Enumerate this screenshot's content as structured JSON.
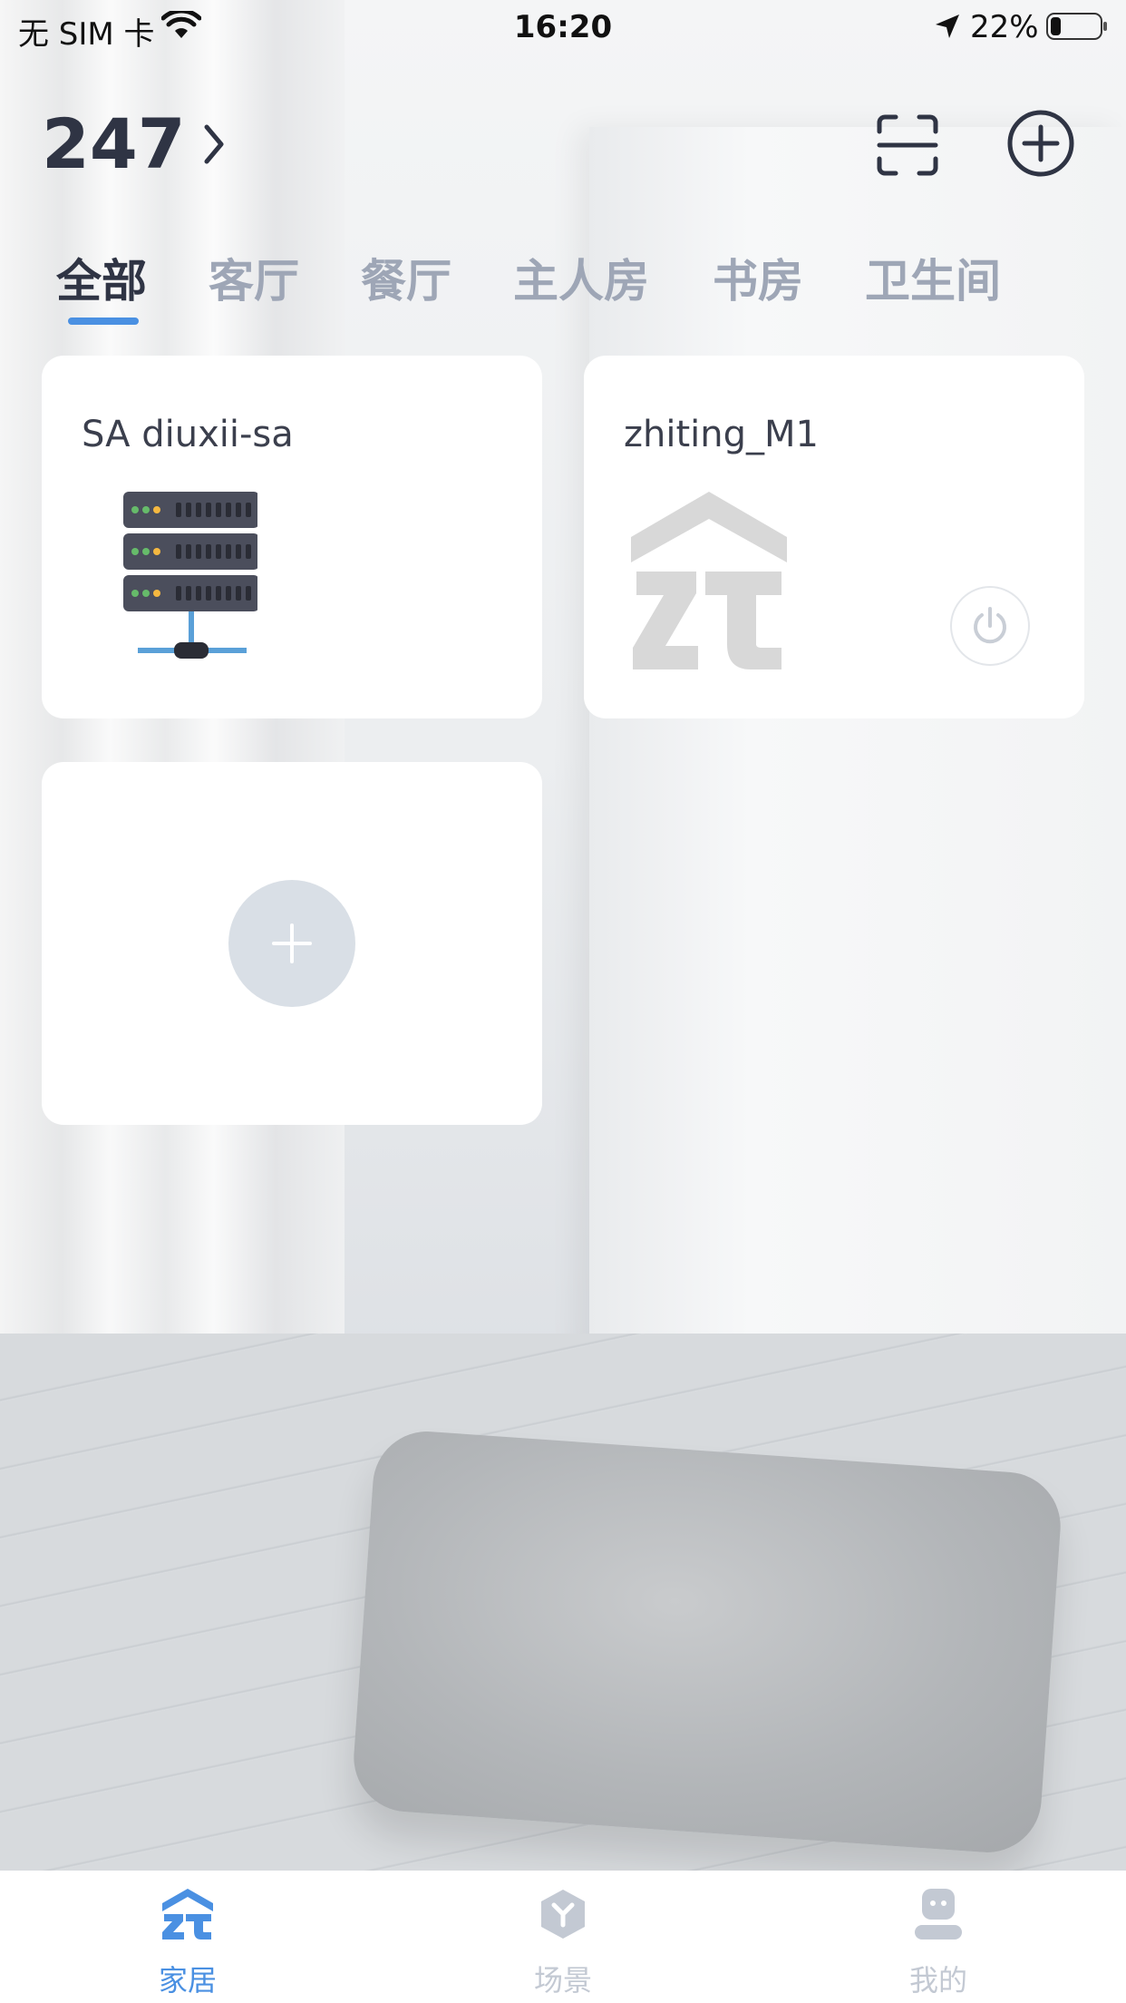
{
  "status_bar": {
    "carrier": "无 SIM 卡",
    "time": "16:20",
    "battery": "22%",
    "battery_level": 0.22
  },
  "header": {
    "home_name": "247"
  },
  "room_tabs": [
    {
      "label": "全部",
      "active": true
    },
    {
      "label": "客厅",
      "active": false
    },
    {
      "label": "餐厅",
      "active": false
    },
    {
      "label": "主人房",
      "active": false
    },
    {
      "label": "书房",
      "active": false
    },
    {
      "label": "卫生间",
      "active": false
    }
  ],
  "devices": [
    {
      "name": "SA diuxii-sa",
      "icon": "server-icon"
    },
    {
      "name": "zhiting_M1",
      "icon": "zt-logo-icon"
    }
  ],
  "bottom_tabs": [
    {
      "label": "家居",
      "icon": "home-zt-icon",
      "active": true
    },
    {
      "label": "场景",
      "icon": "scene-icon",
      "active": false
    },
    {
      "label": "我的",
      "icon": "profile-icon",
      "active": false
    }
  ],
  "colors": {
    "accent": "#4a90e2",
    "tab_inactive": "#9ea6b6",
    "text_dark": "#2f3444"
  }
}
